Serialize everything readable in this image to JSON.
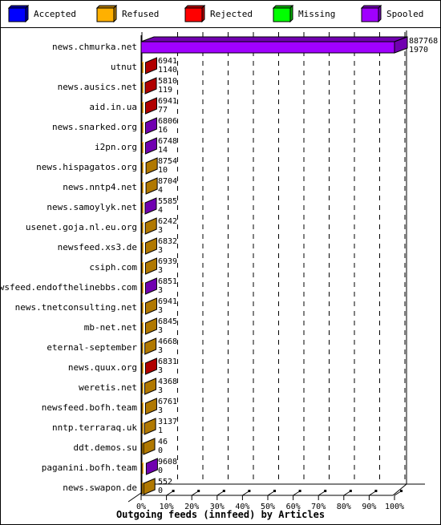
{
  "legend": [
    {
      "label": "Accepted",
      "color": "#0000ff",
      "side": "#0000a0"
    },
    {
      "label": "Refused",
      "color": "#ffb000",
      "side": "#b07800"
    },
    {
      "label": "Rejected",
      "color": "#ff0000",
      "side": "#b00000"
    },
    {
      "label": "Missing",
      "color": "#00ff00",
      "side": "#00b000"
    },
    {
      "label": "Spooled",
      "color": "#a000ff",
      "side": "#7000b0"
    }
  ],
  "chart_data": {
    "type": "bar",
    "orientation": "horizontal",
    "stacked": true,
    "title": "Outgoing feeds (innfeed) by Articles",
    "xlabel": "Outgoing feeds (innfeed) by Articles",
    "ylabel": "",
    "xlim": [
      0,
      100
    ],
    "x_unit": "%",
    "x_ticks": [
      "0%",
      "10%",
      "20%",
      "30%",
      "40%",
      "50%",
      "60%",
      "70%",
      "80%",
      "90%",
      "100%"
    ],
    "grid": "vertical-dashed",
    "legend_position": "top",
    "categories": [
      "news.chmurka.net",
      "utnut",
      "news.ausics.net",
      "aid.in.ua",
      "news.snarked.org",
      "i2pn.org",
      "news.hispagatos.org",
      "news.nntp4.net",
      "news.samoylyk.net",
      "usenet.goja.nl.eu.org",
      "newsfeed.xs3.de",
      "csiph.com",
      "newsfeed.endofthelinebbs.com",
      "news.tnetconsulting.net",
      "mb-net.net",
      "eternal-september",
      "news.quux.org",
      "weretis.net",
      "newsfeed.bofh.team",
      "nntp.terraraq.uk",
      "ddt.demos.su",
      "paganini.bofh.team",
      "news.swapon.de"
    ],
    "offered_labels": [
      "887768",
      "6941",
      "5810",
      "6941",
      "6806",
      "6748",
      "8754",
      "8704",
      "5585",
      "6242",
      "6832",
      "6939",
      "6851",
      "6941",
      "6845",
      "4668",
      "6831",
      "4368",
      "6761",
      "3137",
      "46",
      "9608",
      "552"
    ],
    "accepted_labels": [
      "1970",
      "1140",
      "119",
      "77",
      "16",
      "14",
      "10",
      "4",
      "4",
      "3",
      "3",
      "3",
      "3",
      "3",
      "3",
      "3",
      "3",
      "3",
      "3",
      "1",
      "0",
      "0",
      "0"
    ],
    "dominant_series": [
      "Spooled",
      "Rejected",
      "Rejected",
      "Rejected",
      "Spooled",
      "Spooled",
      "Refused",
      "Refused",
      "Spooled",
      "Refused",
      "Refused",
      "Refused",
      "Spooled",
      "Refused",
      "Refused",
      "Refused",
      "Rejected",
      "Refused",
      "Refused",
      "Refused",
      "Refused",
      "Spooled",
      "Refused"
    ],
    "bar_percent": [
      100,
      0.78,
      0.65,
      0.78,
      0.77,
      0.76,
      0.99,
      0.98,
      0.63,
      0.7,
      0.77,
      0.78,
      0.77,
      0.78,
      0.77,
      0.53,
      0.77,
      0.49,
      0.76,
      0.35,
      0.01,
      1.08,
      0.06
    ]
  }
}
